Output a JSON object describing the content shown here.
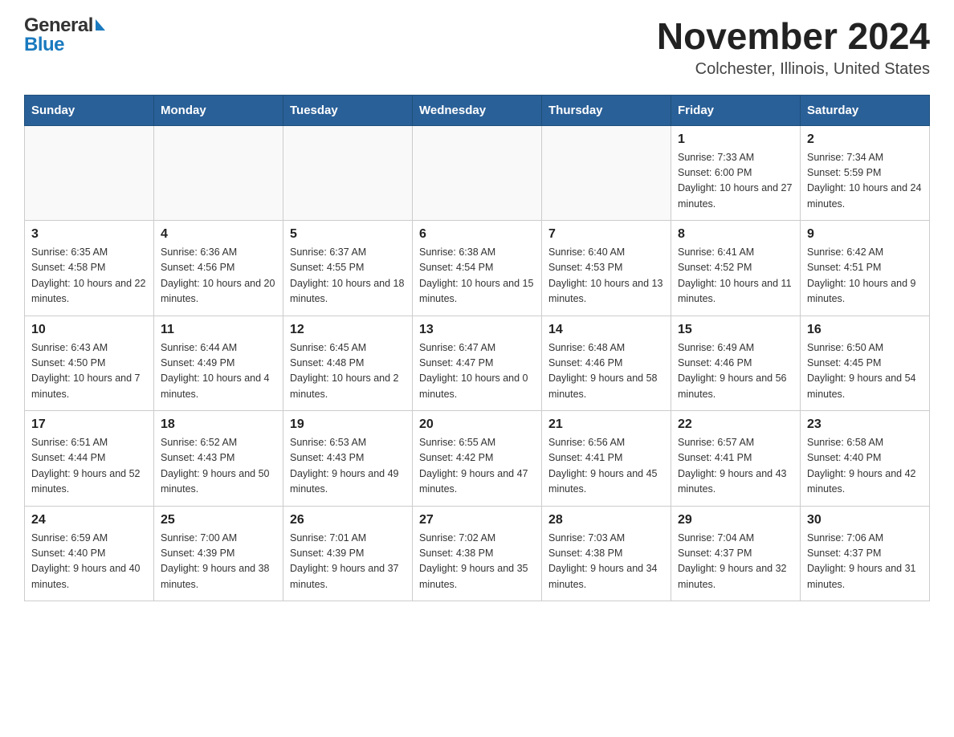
{
  "header": {
    "logo_general": "General",
    "logo_blue": "Blue",
    "title": "November 2024",
    "subtitle": "Colchester, Illinois, United States"
  },
  "days_of_week": [
    "Sunday",
    "Monday",
    "Tuesday",
    "Wednesday",
    "Thursday",
    "Friday",
    "Saturday"
  ],
  "weeks": [
    [
      {
        "day": "",
        "sunrise": "",
        "sunset": "",
        "daylight": ""
      },
      {
        "day": "",
        "sunrise": "",
        "sunset": "",
        "daylight": ""
      },
      {
        "day": "",
        "sunrise": "",
        "sunset": "",
        "daylight": ""
      },
      {
        "day": "",
        "sunrise": "",
        "sunset": "",
        "daylight": ""
      },
      {
        "day": "",
        "sunrise": "",
        "sunset": "",
        "daylight": ""
      },
      {
        "day": "1",
        "sunrise": "Sunrise: 7:33 AM",
        "sunset": "Sunset: 6:00 PM",
        "daylight": "Daylight: 10 hours and 27 minutes."
      },
      {
        "day": "2",
        "sunrise": "Sunrise: 7:34 AM",
        "sunset": "Sunset: 5:59 PM",
        "daylight": "Daylight: 10 hours and 24 minutes."
      }
    ],
    [
      {
        "day": "3",
        "sunrise": "Sunrise: 6:35 AM",
        "sunset": "Sunset: 4:58 PM",
        "daylight": "Daylight: 10 hours and 22 minutes."
      },
      {
        "day": "4",
        "sunrise": "Sunrise: 6:36 AM",
        "sunset": "Sunset: 4:56 PM",
        "daylight": "Daylight: 10 hours and 20 minutes."
      },
      {
        "day": "5",
        "sunrise": "Sunrise: 6:37 AM",
        "sunset": "Sunset: 4:55 PM",
        "daylight": "Daylight: 10 hours and 18 minutes."
      },
      {
        "day": "6",
        "sunrise": "Sunrise: 6:38 AM",
        "sunset": "Sunset: 4:54 PM",
        "daylight": "Daylight: 10 hours and 15 minutes."
      },
      {
        "day": "7",
        "sunrise": "Sunrise: 6:40 AM",
        "sunset": "Sunset: 4:53 PM",
        "daylight": "Daylight: 10 hours and 13 minutes."
      },
      {
        "day": "8",
        "sunrise": "Sunrise: 6:41 AM",
        "sunset": "Sunset: 4:52 PM",
        "daylight": "Daylight: 10 hours and 11 minutes."
      },
      {
        "day": "9",
        "sunrise": "Sunrise: 6:42 AM",
        "sunset": "Sunset: 4:51 PM",
        "daylight": "Daylight: 10 hours and 9 minutes."
      }
    ],
    [
      {
        "day": "10",
        "sunrise": "Sunrise: 6:43 AM",
        "sunset": "Sunset: 4:50 PM",
        "daylight": "Daylight: 10 hours and 7 minutes."
      },
      {
        "day": "11",
        "sunrise": "Sunrise: 6:44 AM",
        "sunset": "Sunset: 4:49 PM",
        "daylight": "Daylight: 10 hours and 4 minutes."
      },
      {
        "day": "12",
        "sunrise": "Sunrise: 6:45 AM",
        "sunset": "Sunset: 4:48 PM",
        "daylight": "Daylight: 10 hours and 2 minutes."
      },
      {
        "day": "13",
        "sunrise": "Sunrise: 6:47 AM",
        "sunset": "Sunset: 4:47 PM",
        "daylight": "Daylight: 10 hours and 0 minutes."
      },
      {
        "day": "14",
        "sunrise": "Sunrise: 6:48 AM",
        "sunset": "Sunset: 4:46 PM",
        "daylight": "Daylight: 9 hours and 58 minutes."
      },
      {
        "day": "15",
        "sunrise": "Sunrise: 6:49 AM",
        "sunset": "Sunset: 4:46 PM",
        "daylight": "Daylight: 9 hours and 56 minutes."
      },
      {
        "day": "16",
        "sunrise": "Sunrise: 6:50 AM",
        "sunset": "Sunset: 4:45 PM",
        "daylight": "Daylight: 9 hours and 54 minutes."
      }
    ],
    [
      {
        "day": "17",
        "sunrise": "Sunrise: 6:51 AM",
        "sunset": "Sunset: 4:44 PM",
        "daylight": "Daylight: 9 hours and 52 minutes."
      },
      {
        "day": "18",
        "sunrise": "Sunrise: 6:52 AM",
        "sunset": "Sunset: 4:43 PM",
        "daylight": "Daylight: 9 hours and 50 minutes."
      },
      {
        "day": "19",
        "sunrise": "Sunrise: 6:53 AM",
        "sunset": "Sunset: 4:43 PM",
        "daylight": "Daylight: 9 hours and 49 minutes."
      },
      {
        "day": "20",
        "sunrise": "Sunrise: 6:55 AM",
        "sunset": "Sunset: 4:42 PM",
        "daylight": "Daylight: 9 hours and 47 minutes."
      },
      {
        "day": "21",
        "sunrise": "Sunrise: 6:56 AM",
        "sunset": "Sunset: 4:41 PM",
        "daylight": "Daylight: 9 hours and 45 minutes."
      },
      {
        "day": "22",
        "sunrise": "Sunrise: 6:57 AM",
        "sunset": "Sunset: 4:41 PM",
        "daylight": "Daylight: 9 hours and 43 minutes."
      },
      {
        "day": "23",
        "sunrise": "Sunrise: 6:58 AM",
        "sunset": "Sunset: 4:40 PM",
        "daylight": "Daylight: 9 hours and 42 minutes."
      }
    ],
    [
      {
        "day": "24",
        "sunrise": "Sunrise: 6:59 AM",
        "sunset": "Sunset: 4:40 PM",
        "daylight": "Daylight: 9 hours and 40 minutes."
      },
      {
        "day": "25",
        "sunrise": "Sunrise: 7:00 AM",
        "sunset": "Sunset: 4:39 PM",
        "daylight": "Daylight: 9 hours and 38 minutes."
      },
      {
        "day": "26",
        "sunrise": "Sunrise: 7:01 AM",
        "sunset": "Sunset: 4:39 PM",
        "daylight": "Daylight: 9 hours and 37 minutes."
      },
      {
        "day": "27",
        "sunrise": "Sunrise: 7:02 AM",
        "sunset": "Sunset: 4:38 PM",
        "daylight": "Daylight: 9 hours and 35 minutes."
      },
      {
        "day": "28",
        "sunrise": "Sunrise: 7:03 AM",
        "sunset": "Sunset: 4:38 PM",
        "daylight": "Daylight: 9 hours and 34 minutes."
      },
      {
        "day": "29",
        "sunrise": "Sunrise: 7:04 AM",
        "sunset": "Sunset: 4:37 PM",
        "daylight": "Daylight: 9 hours and 32 minutes."
      },
      {
        "day": "30",
        "sunrise": "Sunrise: 7:06 AM",
        "sunset": "Sunset: 4:37 PM",
        "daylight": "Daylight: 9 hours and 31 minutes."
      }
    ]
  ]
}
